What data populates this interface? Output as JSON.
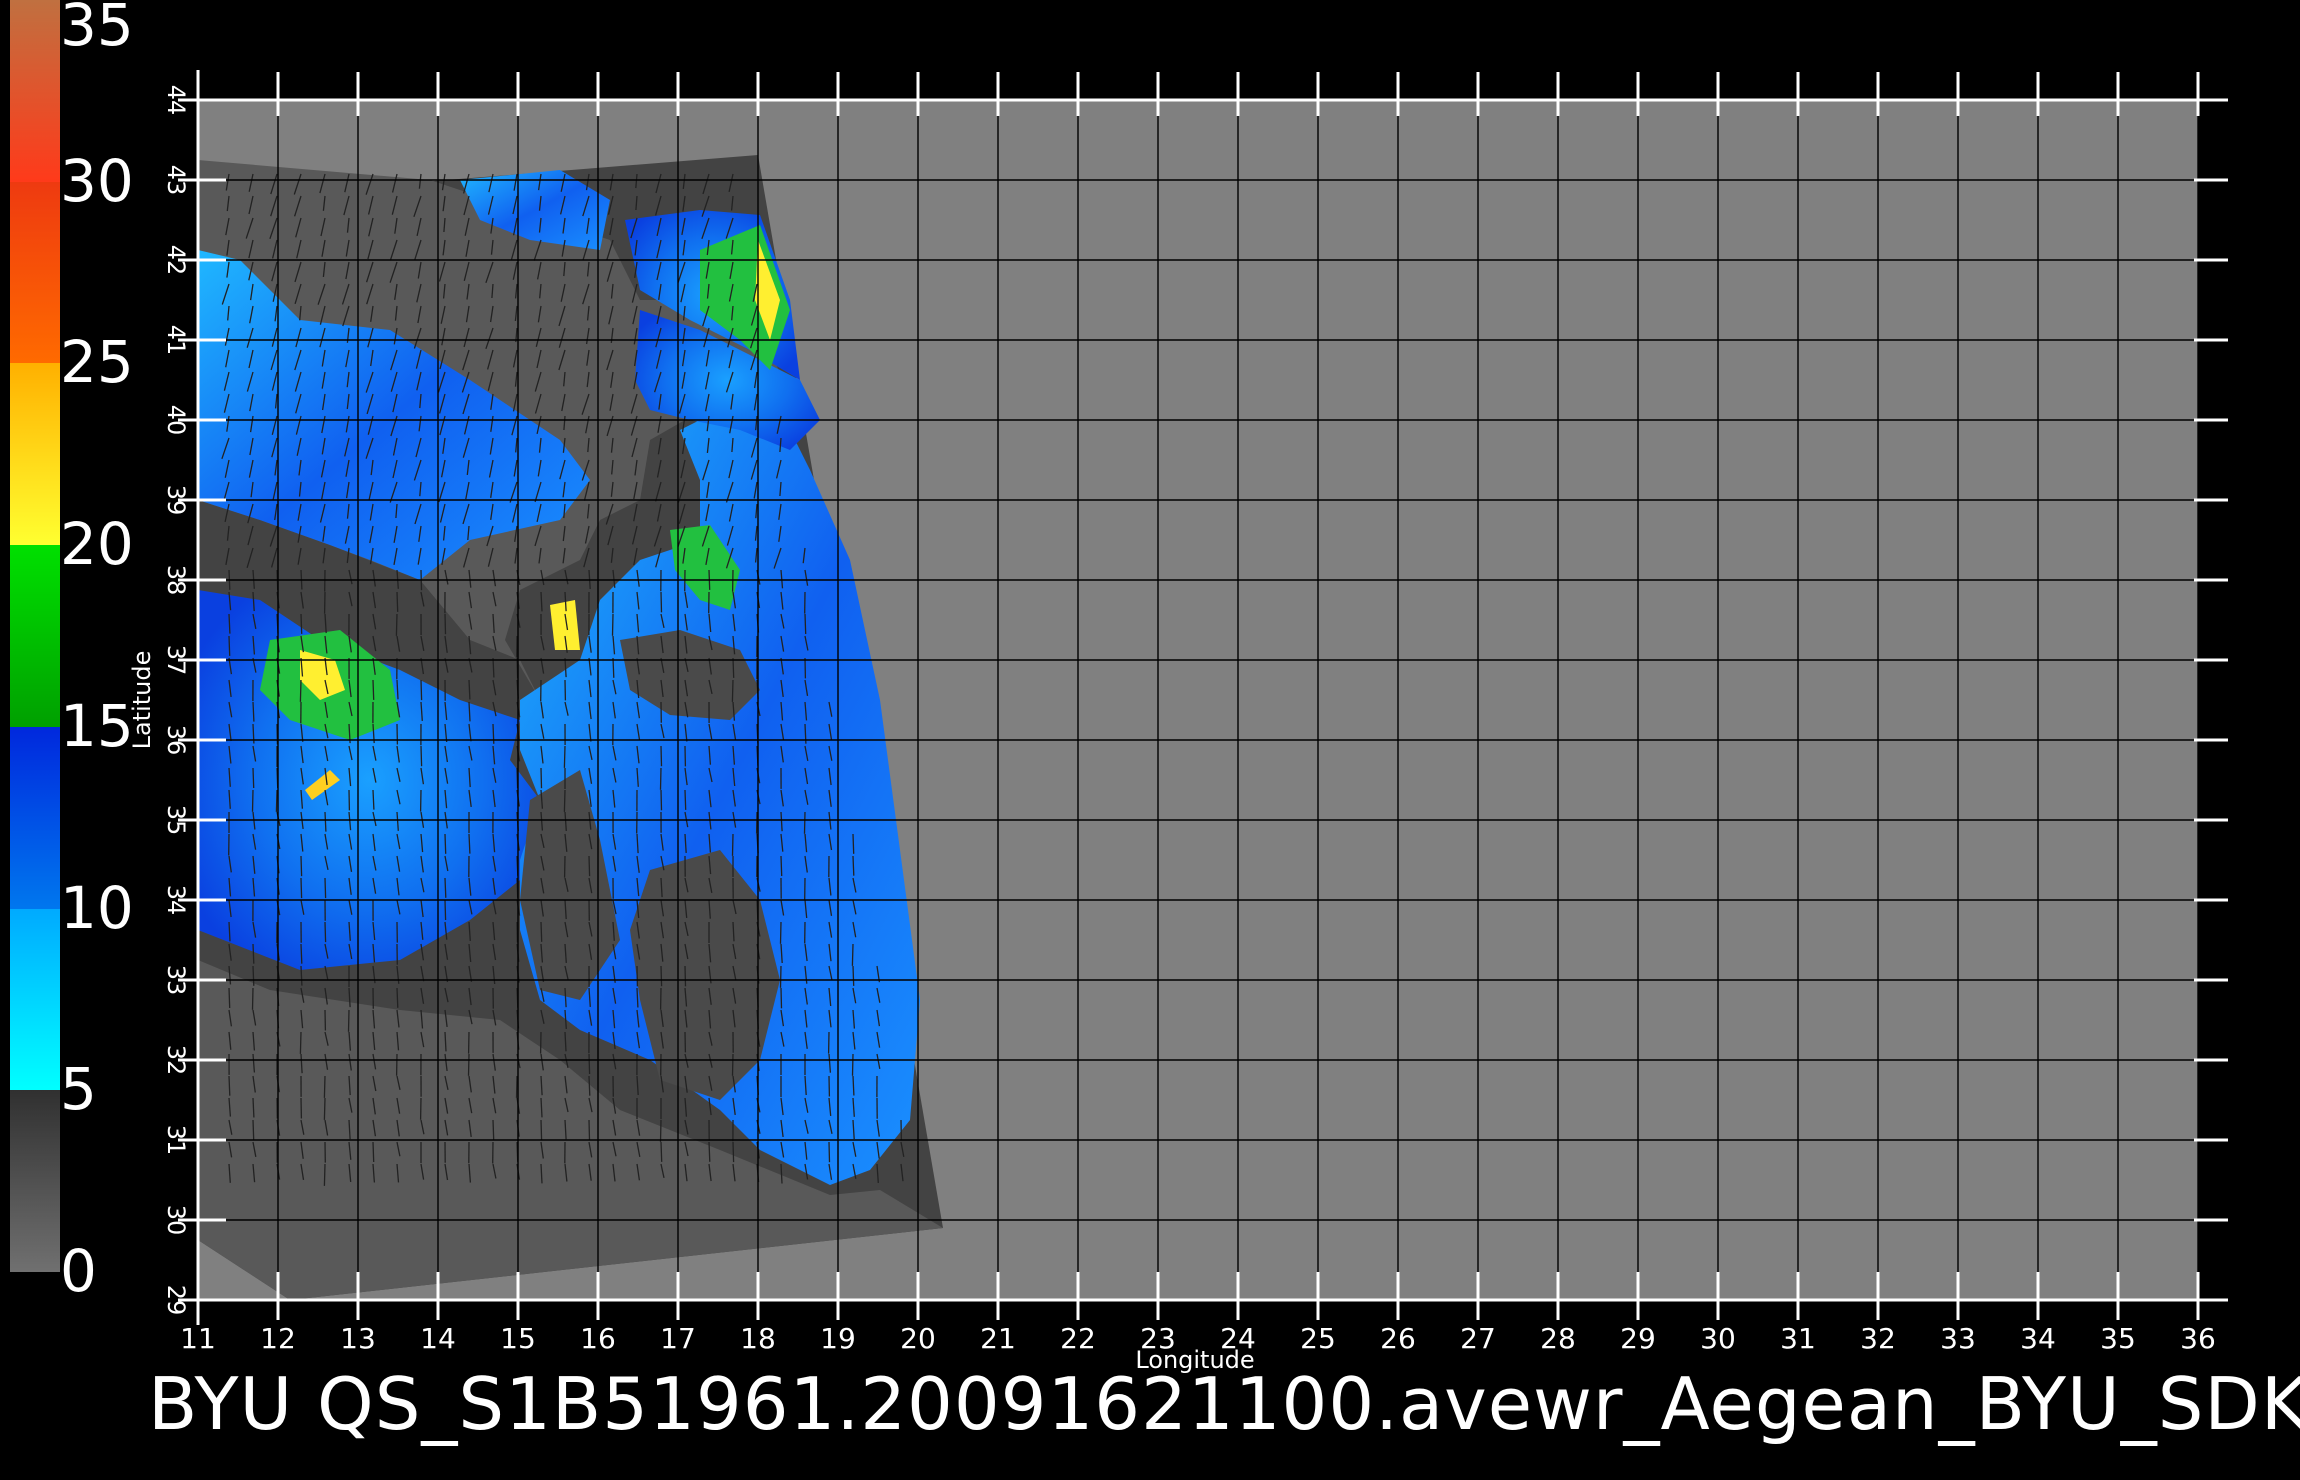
{
  "colorbar": {
    "labels": [
      "35",
      "30",
      "25",
      "20",
      "15",
      "10",
      "5",
      "0"
    ],
    "segments": [
      {
        "from": 30,
        "to": 35,
        "colors": [
          "#ff3a1a",
          "#c07040"
        ]
      },
      {
        "from": 25,
        "to": 30,
        "colors": [
          "#ff6a00",
          "#ee3a10"
        ]
      },
      {
        "from": 20,
        "to": 25,
        "colors": [
          "#ffff30",
          "#ffb000"
        ]
      },
      {
        "from": 15,
        "to": 20,
        "colors": [
          "#00a000",
          "#00e000"
        ]
      },
      {
        "from": 10,
        "to": 15,
        "colors": [
          "#0077ee",
          "#0028dd"
        ]
      },
      {
        "from": 5,
        "to": 10,
        "colors": [
          "#00ffff",
          "#00aaff"
        ]
      },
      {
        "from": 0,
        "to": 5,
        "colors": [
          "#707070",
          "#303030"
        ]
      }
    ]
  },
  "map": {
    "longitude_ticks": [
      "11",
      "12",
      "13",
      "14",
      "15",
      "16",
      "17",
      "18",
      "19",
      "20",
      "21",
      "22",
      "23",
      "24",
      "25",
      "26",
      "27",
      "28",
      "29",
      "30",
      "31",
      "32",
      "33",
      "34",
      "35",
      "36"
    ],
    "latitude_ticks": [
      "29",
      "30",
      "31",
      "32",
      "33",
      "34",
      "35",
      "36",
      "37",
      "38",
      "39",
      "40",
      "41",
      "42",
      "43",
      "44"
    ],
    "x_axis_title": "Longitude",
    "y_axis_title": "Latitude",
    "colors": {
      "background": "#000000",
      "no_data": "#808080",
      "land": "#595959",
      "swath": "#434343",
      "grid": "#000000"
    }
  },
  "footer": {
    "title": "BYU  QS_S1B51961.20091621100.avewr_Aegean_BYU_SDK"
  }
}
